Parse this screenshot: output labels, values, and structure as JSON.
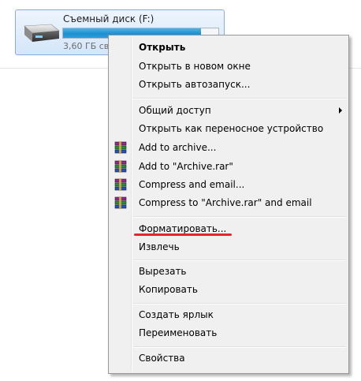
{
  "drive": {
    "name": "Съемный диск (F:)",
    "free_text": "3,60 ГБ сво",
    "used_fraction": 0.89,
    "icon": "removable-drive-icon"
  },
  "menu": {
    "open": "Открыть",
    "open_new_window": "Открыть в новом окне",
    "open_autoplay": "Открыть автозапуск...",
    "sharing": "Общий доступ",
    "open_portable": "Открыть как переносное устройство",
    "add_to_archive": "Add to archive...",
    "add_to_archive_rar": "Add to \"Archive.rar\"",
    "compress_email": "Compress and email...",
    "compress_rar_email": "Compress to \"Archive.rar\" and email",
    "format": "Форматировать...",
    "eject": "Извлечь",
    "cut": "Вырезать",
    "copy": "Копировать",
    "create_shortcut": "Создать ярлык",
    "rename": "Переименовать",
    "properties": "Свойства",
    "archive_icon": "winrar-books-icon",
    "submenu_icon": "submenu-arrow-icon"
  },
  "colors": {
    "highlight_underline": "#e3262c",
    "selection_border": "#84acdd",
    "drive_bar": "#1e8fcf"
  }
}
